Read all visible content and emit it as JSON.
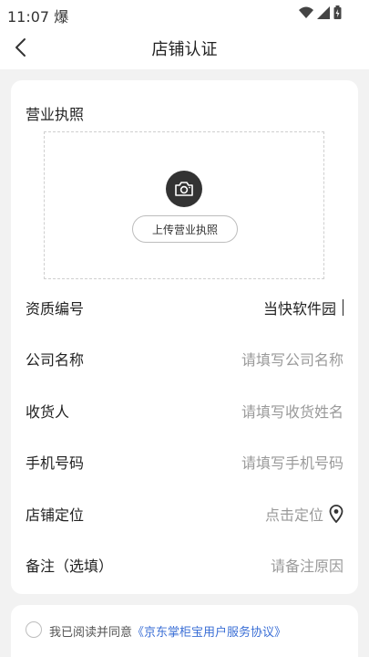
{
  "status_bar": {
    "time": "11:07",
    "carrier_glyph": "爆"
  },
  "header": {
    "title": "店铺认证"
  },
  "form": {
    "license": {
      "label": "营业执照",
      "upload_button": "上传营业执照"
    },
    "fields": [
      {
        "label": "资质编号",
        "value": "当快软件园",
        "placeholder": ""
      },
      {
        "label": "公司名称",
        "value": "",
        "placeholder": "请填写公司名称"
      },
      {
        "label": "收货人",
        "value": "",
        "placeholder": "请填写收货姓名"
      },
      {
        "label": "手机号码",
        "value": "",
        "placeholder": "请填写手机号码"
      },
      {
        "label": "店铺定位",
        "value": "",
        "placeholder": "点击定位"
      },
      {
        "label": "备注（选填）",
        "value": "",
        "placeholder": "请备注原因"
      }
    ]
  },
  "agreement": {
    "prefix": "我已阅读并同意",
    "link": "《京东掌柜宝用户服务协议》",
    "checked": false
  },
  "colors": {
    "link": "#3b6fd6",
    "camera_bg": "#333333",
    "placeholder": "#9a9a9a"
  },
  "icons": [
    "back-arrow-icon",
    "camera-icon",
    "location-pin-icon",
    "wifi-icon",
    "signal-icon",
    "battery-icon"
  ]
}
